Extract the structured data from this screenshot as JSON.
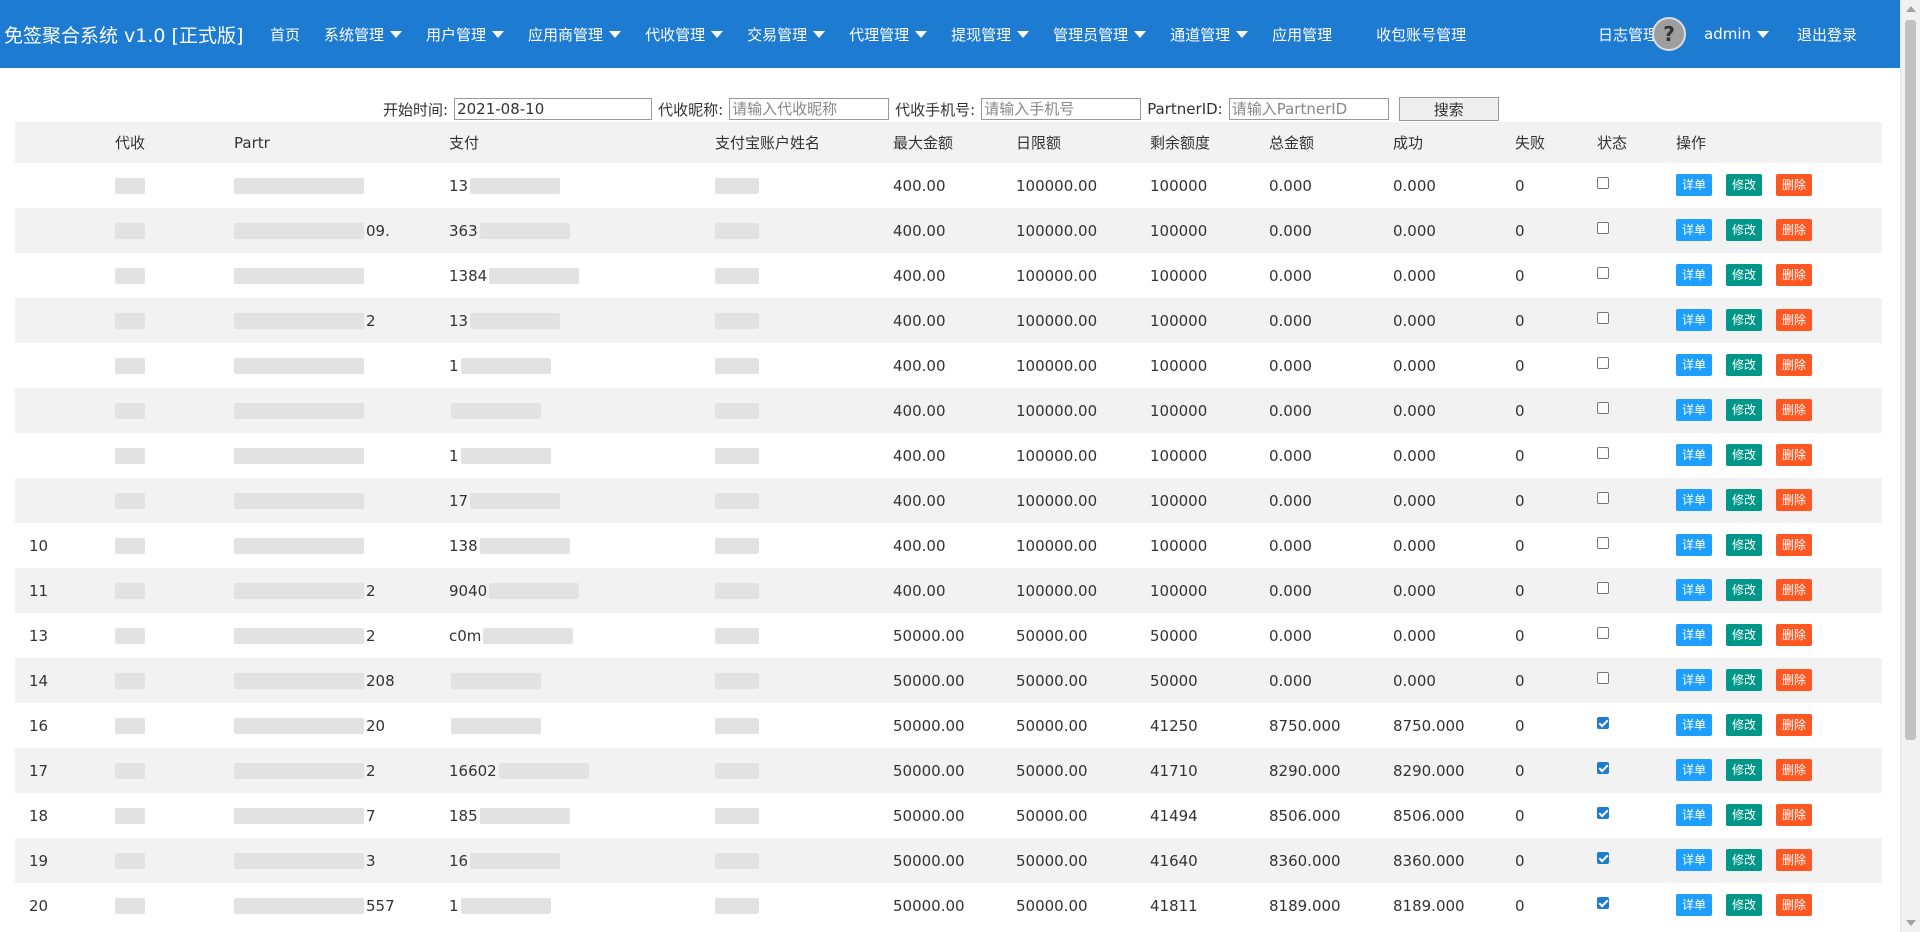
{
  "header": {
    "brand": "免签聚合系统 v1.0 [正式版]",
    "nav": [
      {
        "label": "首页",
        "dropdown": false
      },
      {
        "label": "系统管理",
        "dropdown": true
      },
      {
        "label": "用户管理",
        "dropdown": true
      },
      {
        "label": "应用商管理",
        "dropdown": true
      },
      {
        "label": "代收管理",
        "dropdown": true
      },
      {
        "label": "交易管理",
        "dropdown": true
      },
      {
        "label": "代理管理",
        "dropdown": true
      },
      {
        "label": "提现管理",
        "dropdown": true
      },
      {
        "label": "管理员管理",
        "dropdown": true
      },
      {
        "label": "通道管理",
        "dropdown": true
      },
      {
        "label": "应用管理",
        "dropdown": false
      },
      {
        "label": "收包账号管理",
        "dropdown": false
      }
    ],
    "log_label": "日志管理",
    "user_name": "admin",
    "logout_label": "退出登录",
    "avatar_glyph": "?"
  },
  "search": {
    "start_label": "开始时间:",
    "start_value": "2021-08-10",
    "nick_label": "代收昵称:",
    "nick_placeholder": "请输入代收昵称",
    "phone_label": "代收手机号:",
    "phone_placeholder": "请输入手机号",
    "partner_label": "PartnerID:",
    "partner_placeholder": "请输入PartnerID",
    "button_label": "搜索"
  },
  "table": {
    "headers": [
      "",
      "代收",
      "Partr",
      "支付",
      "支付宝账户姓名",
      "最大金额",
      "日限额",
      "剩余额度",
      "总金额",
      "成功",
      "失败",
      "状态",
      "操作"
    ],
    "buttons": {
      "detail": "详单",
      "edit": "修改",
      "delete": "删除"
    },
    "rows": [
      {
        "id": "",
        "partner": "",
        "pay": "13",
        "max": "400.00",
        "day": "100000.00",
        "remain": "100000",
        "total": "0.000",
        "success": "0.000",
        "fail": "0",
        "status": false
      },
      {
        "id": "",
        "partner": "09.",
        "pay": "363",
        "max": "400.00",
        "day": "100000.00",
        "remain": "100000",
        "total": "0.000",
        "success": "0.000",
        "fail": "0",
        "status": false
      },
      {
        "id": "",
        "partner": "",
        "pay": "1384",
        "max": "400.00",
        "day": "100000.00",
        "remain": "100000",
        "total": "0.000",
        "success": "0.000",
        "fail": "0",
        "status": false
      },
      {
        "id": "",
        "partner": "2",
        "pay": "13",
        "max": "400.00",
        "day": "100000.00",
        "remain": "100000",
        "total": "0.000",
        "success": "0.000",
        "fail": "0",
        "status": false
      },
      {
        "id": "",
        "partner": "",
        "pay": "1",
        "max": "400.00",
        "day": "100000.00",
        "remain": "100000",
        "total": "0.000",
        "success": "0.000",
        "fail": "0",
        "status": false
      },
      {
        "id": "",
        "partner": "",
        "pay": "",
        "max": "400.00",
        "day": "100000.00",
        "remain": "100000",
        "total": "0.000",
        "success": "0.000",
        "fail": "0",
        "status": false
      },
      {
        "id": "",
        "partner": "",
        "pay": "1",
        "max": "400.00",
        "day": "100000.00",
        "remain": "100000",
        "total": "0.000",
        "success": "0.000",
        "fail": "0",
        "status": false
      },
      {
        "id": "",
        "partner": "",
        "pay": "17",
        "max": "400.00",
        "day": "100000.00",
        "remain": "100000",
        "total": "0.000",
        "success": "0.000",
        "fail": "0",
        "status": false
      },
      {
        "id": "10",
        "partner": "",
        "pay": "138",
        "max": "400.00",
        "day": "100000.00",
        "remain": "100000",
        "total": "0.000",
        "success": "0.000",
        "fail": "0",
        "status": false
      },
      {
        "id": "11",
        "partner": "2",
        "pay": "9040",
        "max": "400.00",
        "day": "100000.00",
        "remain": "100000",
        "total": "0.000",
        "success": "0.000",
        "fail": "0",
        "status": false
      },
      {
        "id": "13",
        "partner": "2",
        "pay": "c0m",
        "max": "50000.00",
        "day": "50000.00",
        "remain": "50000",
        "total": "0.000",
        "success": "0.000",
        "fail": "0",
        "status": false
      },
      {
        "id": "14",
        "partner": "208",
        "pay": "",
        "max": "50000.00",
        "day": "50000.00",
        "remain": "50000",
        "total": "0.000",
        "success": "0.000",
        "fail": "0",
        "status": false
      },
      {
        "id": "16",
        "partner": "20",
        "pay": "",
        "max": "50000.00",
        "day": "50000.00",
        "remain": "41250",
        "total": "8750.000",
        "success": "8750.000",
        "fail": "0",
        "status": true
      },
      {
        "id": "17",
        "partner": "2",
        "pay": "16602",
        "max": "50000.00",
        "day": "50000.00",
        "remain": "41710",
        "total": "8290.000",
        "success": "8290.000",
        "fail": "0",
        "status": true
      },
      {
        "id": "18",
        "partner": "7",
        "pay": "185",
        "max": "50000.00",
        "day": "50000.00",
        "remain": "41494",
        "total": "8506.000",
        "success": "8506.000",
        "fail": "0",
        "status": true
      },
      {
        "id": "19",
        "partner": "3",
        "pay": "16",
        "max": "50000.00",
        "day": "50000.00",
        "remain": "41640",
        "total": "8360.000",
        "success": "8360.000",
        "fail": "0",
        "status": true
      },
      {
        "id": "20",
        "partner": "557",
        "pay": "1",
        "max": "50000.00",
        "day": "50000.00",
        "remain": "41811",
        "total": "8189.000",
        "success": "8189.000",
        "fail": "0",
        "status": true
      }
    ]
  },
  "colors": {
    "topbar": "#1e7bd2",
    "detail": "#1e9fff",
    "edit": "#009688",
    "delete": "#ff5722"
  }
}
